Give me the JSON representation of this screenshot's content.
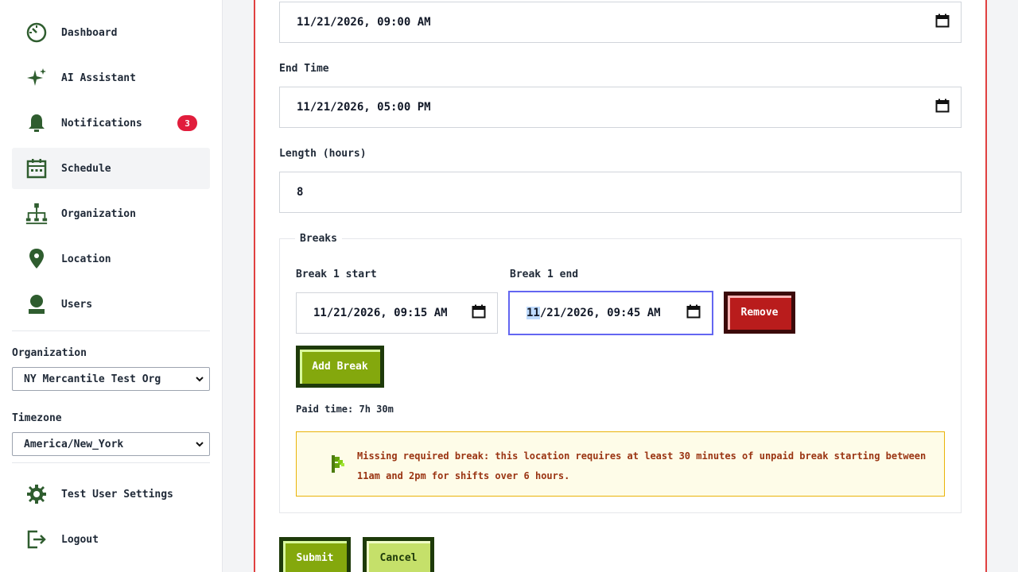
{
  "sidebar": {
    "items": [
      {
        "label": "Dashboard",
        "icon": "gauge-icon"
      },
      {
        "label": "AI Assistant",
        "icon": "sparkle-icon"
      },
      {
        "label": "Notifications",
        "icon": "bell-icon",
        "badge": "3"
      },
      {
        "label": "Schedule",
        "icon": "calendar-icon",
        "active": true
      },
      {
        "label": "Organization",
        "icon": "org-chart-icon"
      },
      {
        "label": "Location",
        "icon": "map-pin-icon"
      },
      {
        "label": "Users",
        "icon": "user-icon"
      }
    ],
    "organization_label": "Organization",
    "organization_value": "NY Mercantile Test Org",
    "timezone_label": "Timezone",
    "timezone_value": "America/New_York",
    "settings_label": "Test User Settings",
    "logout_label": "Logout"
  },
  "form": {
    "start_time_value": "11/21/2026, 09:00 AM",
    "end_time_label": "End Time",
    "end_time_value": "11/21/2026, 05:00 PM",
    "length_label": "Length (hours)",
    "length_value": "8",
    "breaks_legend": "Breaks",
    "break1_start_label": "Break 1 start",
    "break1_start_value": "11/21/2026, 09:15 AM",
    "break1_end_label": "Break 1 end",
    "break1_end_value_selected": "11",
    "break1_end_value_rest": "/21/2026, 09:45 AM",
    "remove_label": "Remove",
    "add_break_label": "Add Break",
    "paid_time": "Paid time: 7h 30m",
    "warning_text": "Missing required break: this location requires at least 30 minutes of unpaid break starting between 11am and 2pm for shifts over 6 hours.",
    "submit_label": "Submit",
    "cancel_label": "Cancel"
  },
  "colors": {
    "icon_green": "#2f5d2f",
    "badge_red": "#e11d3c",
    "panel_border": "#e04040",
    "warning_text": "#9a3412"
  }
}
